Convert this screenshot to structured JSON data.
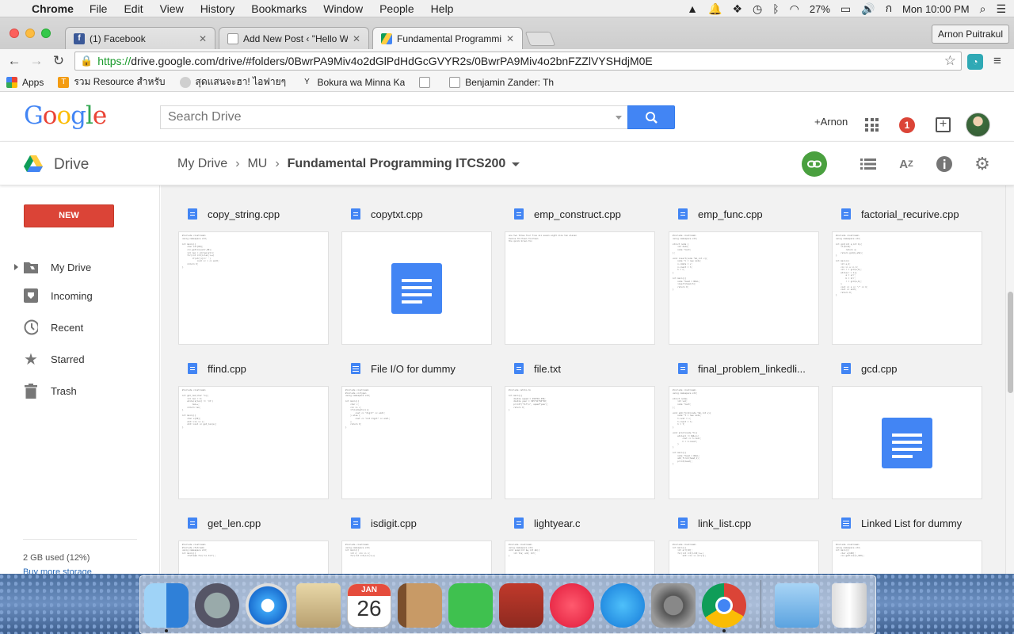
{
  "menubar": {
    "app": "Chrome",
    "items": [
      "File",
      "Edit",
      "View",
      "History",
      "Bookmarks",
      "Window",
      "People",
      "Help"
    ],
    "battery": "27%",
    "clock": "Mon 10:00 PM"
  },
  "tabs": [
    {
      "title": "(1) Facebook"
    },
    {
      "title": "Add New Post ‹ \"Hello Wor"
    },
    {
      "title": "Fundamental Programming"
    }
  ],
  "profile_name": "Arnon Puitrakul",
  "url": {
    "scheme": "https://",
    "rest": "drive.google.com/drive/#folders/0BwrPA9Miv4o2dGlPdHdGcGVYR2s/0BwrPA9Miv4o2bnFZZlVYSHdjM0E"
  },
  "bookmarks": [
    {
      "label": "Apps"
    },
    {
      "label": "รวม Resource สำหรับ"
    },
    {
      "label": "สุดแสนจะฮา! ไอฟายๆ ฮิ"
    },
    {
      "label": "Bokura wa Minna Ka"
    },
    {
      "label": ""
    },
    {
      "label": "Benjamin Zander: Th"
    }
  ],
  "search": {
    "placeholder": "Search Drive"
  },
  "header": {
    "user": "+Arnon",
    "notifications": "1"
  },
  "drive": {
    "label": "Drive",
    "breadcrumb": [
      "My Drive",
      "MU",
      "Fundamental Programming ITCS200"
    ]
  },
  "sidebar": {
    "new_label": "NEW",
    "items": [
      {
        "label": "My Drive"
      },
      {
        "label": "Incoming"
      },
      {
        "label": "Recent"
      },
      {
        "label": "Starred"
      },
      {
        "label": "Trash"
      }
    ],
    "storage": "2 GB used (12%)",
    "buy": "Buy more storage"
  },
  "files": {
    "row0": [
      "copy_string.cpp",
      "copytxt.cpp",
      "emp_construct.cpp",
      "emp_func.cpp",
      "factorial_recurive.cpp"
    ],
    "row1": [
      "ffind.cpp",
      "File I/O for dummy",
      "file.txt",
      "final_problem_linkedli...",
      "gcd.cpp"
    ],
    "row2": [
      "get_len.cpp",
      "isdigit.cpp",
      "lightyear.c",
      "link_list.cpp",
      "Linked List for dummy"
    ]
  },
  "dock": {
    "calendar_month": "JAN",
    "calendar_day": "26"
  },
  "colors": {
    "accent": "#4285f4",
    "new_button": "#db4437",
    "link_button": "#4aa03f",
    "https": "#1a9b2c"
  }
}
